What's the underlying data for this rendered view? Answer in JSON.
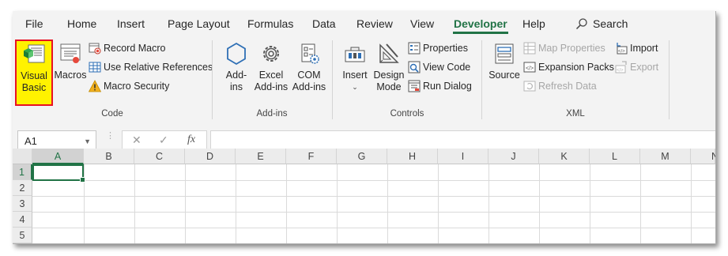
{
  "tabs": [
    "File",
    "Home",
    "Insert",
    "Page Layout",
    "Formulas",
    "Data",
    "Review",
    "View",
    "Developer",
    "Help"
  ],
  "active_tab": "Developer",
  "search_label": "Search",
  "groups": {
    "code": {
      "label": "Code",
      "visual_basic": [
        "Visual",
        "Basic"
      ],
      "macros": "Macros",
      "record_macro": "Record Macro",
      "use_relative_references": "Use Relative References",
      "macro_security": "Macro Security"
    },
    "addins": {
      "label": "Add-ins",
      "addins": [
        "Add-",
        "ins"
      ],
      "excel_addins": [
        "Excel",
        "Add-ins"
      ],
      "com_addins": [
        "COM",
        "Add-ins"
      ]
    },
    "controls": {
      "label": "Controls",
      "insert": "Insert",
      "design_mode": [
        "Design",
        "Mode"
      ],
      "properties": "Properties",
      "view_code": "View Code",
      "run_dialog": "Run Dialog"
    },
    "xml": {
      "label": "XML",
      "source": "Source",
      "map_properties": "Map Properties",
      "expansion_packs": "Expansion Packs",
      "refresh_data": "Refresh Data",
      "import": "Import",
      "export": "Export"
    }
  },
  "formula_bar": {
    "name_box": "A1",
    "cancel_glyph": "✕",
    "enter_glyph": "✓",
    "fx_glyph": "fx",
    "value": ""
  },
  "grid": {
    "columns": [
      "A",
      "B",
      "C",
      "D",
      "E",
      "F",
      "G",
      "H",
      "I",
      "J",
      "K",
      "L",
      "M",
      "N"
    ],
    "rows": [
      "1",
      "2",
      "3",
      "4",
      "5"
    ],
    "selected_cell": "A1"
  },
  "colors": {
    "accent": "#217346",
    "highlight": "#fff200",
    "highlight_border": "#e81123"
  }
}
